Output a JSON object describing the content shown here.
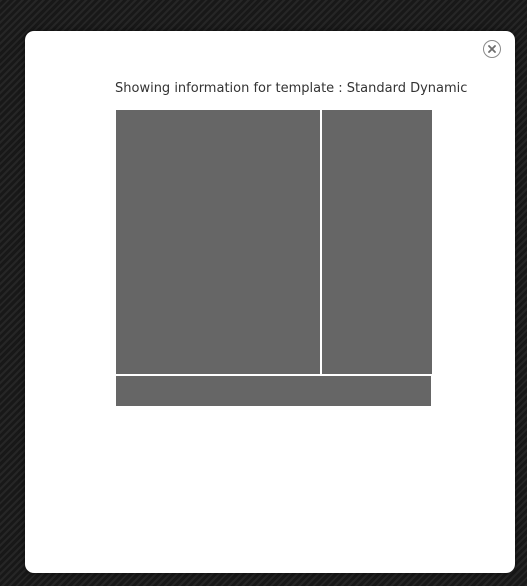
{
  "dialog": {
    "title": "Showing information for template : Standard Dynamic",
    "close_icon": "close-icon"
  },
  "template_preview": {
    "zones": [
      {
        "id": "main"
      },
      {
        "id": "side"
      },
      {
        "id": "bottom"
      }
    ],
    "colors": {
      "zone_fill": "#666666",
      "zone_divider": "#ffffff",
      "backdrop": "#1e1e1e",
      "dialog_bg": "#ffffff"
    }
  }
}
